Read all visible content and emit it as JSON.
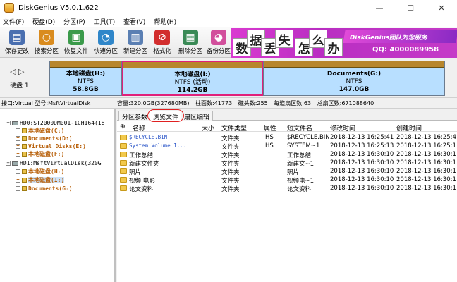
{
  "window": {
    "title": "DiskGenius V5.0.1.622",
    "min": "—",
    "max": "☐",
    "close": "✕"
  },
  "menu": [
    "文件(F)",
    "硬盘(D)",
    "分区(P)",
    "工具(T)",
    "查看(V)",
    "帮助(H)"
  ],
  "toolbar": [
    {
      "label": "保存更改",
      "icon": "save-icon",
      "color": "#4a6fb0",
      "glyph": "▤"
    },
    {
      "label": "搜索分区",
      "icon": "magnifier-icon",
      "color": "#d98b1e",
      "glyph": "○"
    },
    {
      "label": "恢复文件",
      "icon": "recover-files-icon",
      "color": "#3a9a4a",
      "glyph": "▣"
    },
    {
      "label": "快速分区",
      "icon": "quick-partition-icon",
      "color": "#2f86c9",
      "glyph": "◔"
    },
    {
      "label": "新建分区",
      "icon": "new-partition-icon",
      "color": "#5a7fb3",
      "glyph": "▥"
    },
    {
      "label": "格式化",
      "icon": "format-icon",
      "color": "#d22d2d",
      "glyph": "⊘"
    },
    {
      "label": "删除分区",
      "icon": "delete-partition-icon",
      "color": "#3a8a56",
      "glyph": "▦"
    },
    {
      "label": "备份分区",
      "icon": "backup-partition-icon",
      "color": "#d24f9c",
      "glyph": "◕"
    }
  ],
  "banner": {
    "chars": [
      "数",
      "据",
      "丢",
      "失",
      "怎",
      "么",
      "办"
    ],
    "slogan": "DiskGenius团队为您服务",
    "qq": "QQ: 4000089958"
  },
  "disk": {
    "nav_left": "◁",
    "nav_right": "▷",
    "label": "硬盘 1",
    "partitions": [
      {
        "name": "本地磁盘(H:)",
        "fs": "NTFS",
        "size": "58.8GB"
      },
      {
        "name": "本地磁盘(I:)",
        "fs": "NTFS (活动)",
        "size": "114.2GB"
      },
      {
        "name": "Documents(G:)",
        "fs": "NTFS",
        "size": "147.0GB"
      }
    ]
  },
  "info": {
    "iface": "接口:Virtual  型号:MsftVirtualDisk",
    "capacity": "容量:320.0GB(327680MB)",
    "cyl": "柱面数:41773",
    "heads": "磁头数:255",
    "spt": "每道扇区数:63",
    "sectors": "总扇区数:671088640"
  },
  "tree": [
    {
      "text": "HD0:ST2000DM001-1CH164(18",
      "kind": "disk",
      "box": "−"
    },
    {
      "text": "本地磁盘(C:)",
      "kind": "part",
      "box": "+"
    },
    {
      "text": "Documents(D:)",
      "kind": "part",
      "box": "+"
    },
    {
      "text": "Virtual Disks(E:)",
      "kind": "part",
      "box": "+"
    },
    {
      "text": "本地磁盘(F:)",
      "kind": "part",
      "box": "+"
    },
    {
      "text": "HD1:MsftVirtualDisk(320G",
      "kind": "disk",
      "box": "−"
    },
    {
      "text": "本地磁盘(H:)",
      "kind": "part",
      "box": "+"
    },
    {
      "text": "本地磁盘(I:)",
      "kind": "part",
      "box": "+"
    },
    {
      "text": "Documents(G:)",
      "kind": "part",
      "box": "+"
    }
  ],
  "tabs": [
    "分区参数",
    "浏览文件",
    "扇区编辑"
  ],
  "columns": [
    "名称",
    "大小",
    "文件类型",
    "属性",
    "短文件名",
    "修改时间",
    "创建时间"
  ],
  "files": [
    {
      "name": "$RECYCLE.BIN",
      "size": "",
      "type": "文件夹",
      "attr": "HS",
      "short": "$RECYCLE.BIN",
      "mtime": "2018-12-13 16:25:41",
      "ctime": "2018-12-13 16:25:4"
    },
    {
      "name": "System Volume I...",
      "size": "",
      "type": "文件夹",
      "attr": "HS",
      "short": "SYSTEM~1",
      "mtime": "2018-12-13 16:25:13",
      "ctime": "2018-12-13 16:25:1"
    },
    {
      "name": "工作总结",
      "size": "",
      "type": "文件夹",
      "attr": "",
      "short": "工作总结",
      "mtime": "2018-12-13 16:30:10",
      "ctime": "2018-12-13 16:30:1"
    },
    {
      "name": "新建文件夹",
      "size": "",
      "type": "文件夹",
      "attr": "",
      "short": "新建文~1",
      "mtime": "2018-12-13 16:30:10",
      "ctime": "2018-12-13 16:30:1"
    },
    {
      "name": "照片",
      "size": "",
      "type": "文件夹",
      "attr": "",
      "short": "照片",
      "mtime": "2018-12-13 16:30:10",
      "ctime": "2018-12-13 16:30:1"
    },
    {
      "name": "视频 电影",
      "size": "",
      "type": "文件夹",
      "attr": "",
      "short": "视频电~1",
      "mtime": "2018-12-13 16:30:10",
      "ctime": "2018-12-13 16:30:1"
    },
    {
      "name": "论文资料",
      "size": "",
      "type": "文件夹",
      "attr": "",
      "short": "论文资料",
      "mtime": "2018-12-13 16:30:10",
      "ctime": "2018-12-13 16:30:1"
    }
  ]
}
